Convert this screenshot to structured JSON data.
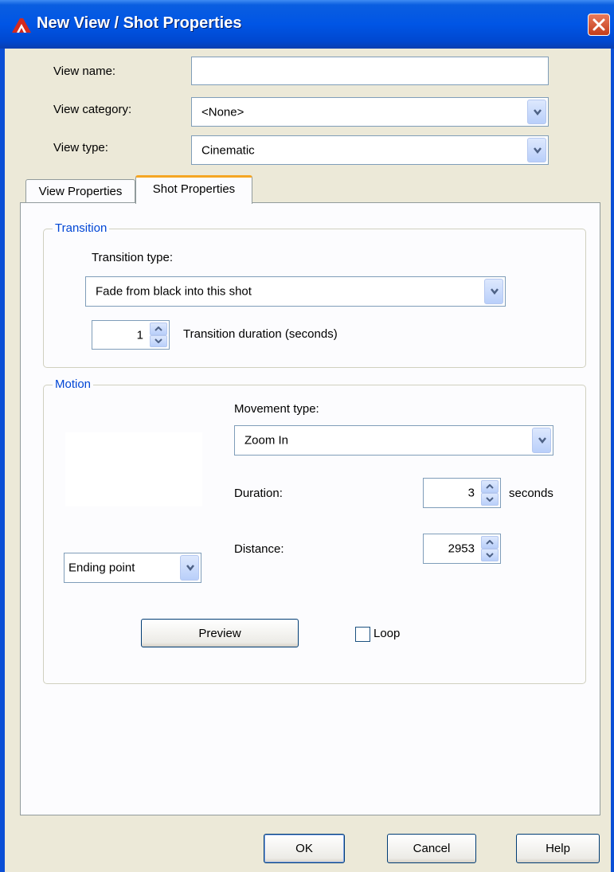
{
  "window": {
    "title": "New View / Shot Properties"
  },
  "fields": {
    "view_name_label": "View name:",
    "view_name_value": "",
    "view_category_label": "View category:",
    "view_category_value": "<None>",
    "view_type_label": "View type:",
    "view_type_value": "Cinematic"
  },
  "tabs": [
    {
      "label": "View Properties",
      "active": false
    },
    {
      "label": "Shot Properties",
      "active": true
    }
  ],
  "transition": {
    "group_title": "Transition",
    "type_label": "Transition type:",
    "type_value": "Fade from black into this shot",
    "duration_value": "1",
    "duration_label": "Transition duration (seconds)"
  },
  "motion": {
    "group_title": "Motion",
    "movement_type_label": "Movement type:",
    "movement_type_value": "Zoom In",
    "duration_label": "Duration:",
    "duration_value": "3",
    "duration_unit": "seconds",
    "distance_label": "Distance:",
    "distance_value": "2953",
    "point_value": "Ending point"
  },
  "preview": {
    "button_label": "Preview",
    "loop_label": "Loop",
    "loop_checked": false
  },
  "footer": {
    "ok_label": "OK",
    "cancel_label": "Cancel",
    "help_label": "Help"
  },
  "colors": {
    "titlebar": "#0055e5",
    "group_title": "#0046d5",
    "active_tab_accent": "#f5a623",
    "dialog_bg": "#ece9d8"
  },
  "icons": [
    "autocad-icon",
    "close-icon",
    "chevron-down-icon",
    "spin-up-icon",
    "spin-down-icon"
  ]
}
